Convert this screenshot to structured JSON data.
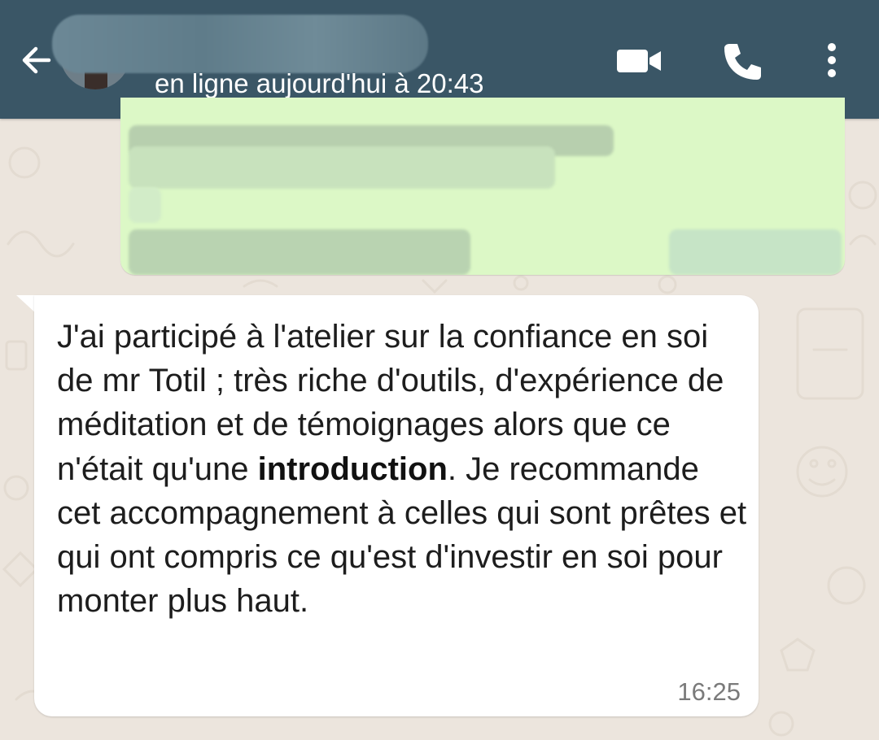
{
  "colors": {
    "header_bg": "#3a5666",
    "chat_bg": "#ece5dd",
    "outgoing_bubble": "#dcf8c6",
    "incoming_bubble": "#ffffff"
  },
  "header": {
    "back_icon": "arrow-left-icon",
    "status": "en ligne aujourd'hui à 20:43",
    "video_icon": "video-camera-icon",
    "call_icon": "phone-icon",
    "menu_icon": "more-vertical-icon"
  },
  "messages": [
    {
      "direction": "outgoing",
      "content_hidden": true
    },
    {
      "direction": "incoming",
      "text_before_bold": "J'ai participé à l'atelier sur la confiance en soi de mr Totil ; très riche d'outils, d'expérience de méditation et de témoignages alors que ce n'était qu'une ",
      "bold_text": "introduction",
      "text_after_bold": ". Je recommande cet accompagnement à celles qui sont prêtes et qui ont compris ce qu'est d'investir en soi pour monter plus haut.",
      "time": "16:25"
    }
  ]
}
